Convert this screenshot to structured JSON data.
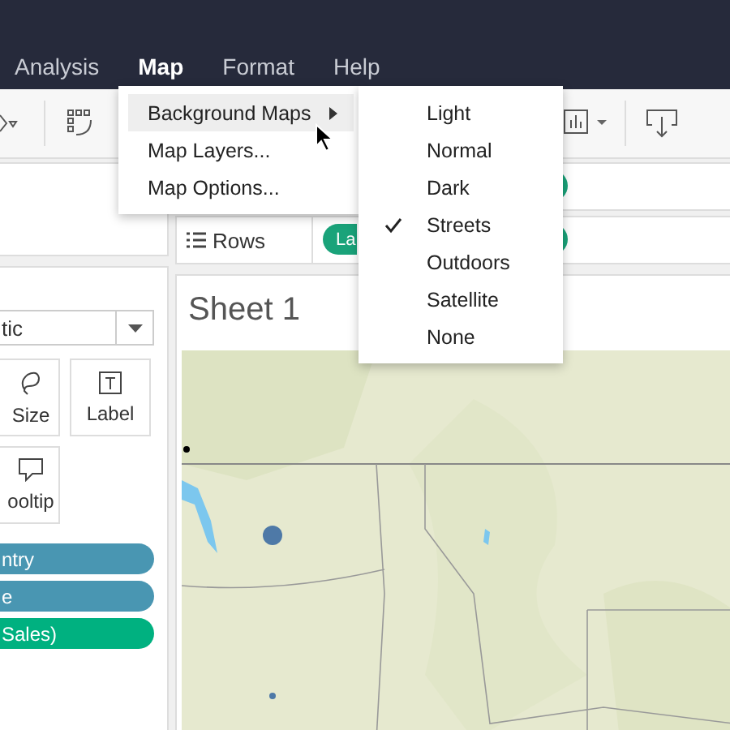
{
  "menu_bar": [
    {
      "label": "Analysis",
      "selected": false
    },
    {
      "label": "Map",
      "selected": true
    },
    {
      "label": "Format",
      "selected": false
    },
    {
      "label": "Help",
      "selected": false
    }
  ],
  "map_menu": [
    {
      "label": "Background Maps",
      "kind": "submenu",
      "selected": true
    },
    {
      "label": "Map Layers...",
      "kind": "item",
      "selected": false
    },
    {
      "label": "Map Options...",
      "kind": "item",
      "selected": false
    }
  ],
  "background_maps": [
    {
      "label": "Light",
      "checked": false
    },
    {
      "label": "Normal",
      "checked": false
    },
    {
      "label": "Dark",
      "checked": false
    },
    {
      "label": "Streets",
      "checked": true
    },
    {
      "label": "Outdoors",
      "checked": false
    },
    {
      "label": "Satellite",
      "checked": false
    },
    {
      "label": "None",
      "checked": false
    }
  ],
  "shelves": {
    "rows_label": "Rows",
    "rows_pill": "La"
  },
  "marks": {
    "mark_type": "tic",
    "buttons": [
      {
        "label": "Size",
        "kind": "size"
      },
      {
        "label": "Label",
        "kind": "label"
      },
      {
        "label": "ooltip",
        "kind": "tooltip"
      }
    ],
    "pills": [
      {
        "label": "ntry",
        "color": "#4996b2"
      },
      {
        "label": "e",
        "color": "#4996b2"
      },
      {
        "label": "Sales)",
        "color": "#00b180"
      }
    ]
  },
  "sheet": {
    "title": "Sheet 1"
  }
}
